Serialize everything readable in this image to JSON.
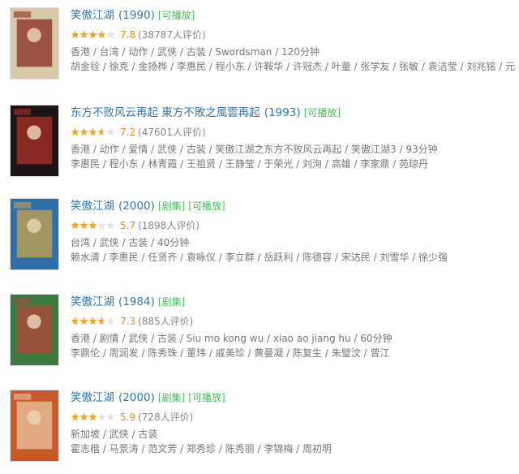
{
  "results": [
    {
      "title": "笑傲江湖",
      "year": "(1990)",
      "tags": [
        "可播放"
      ],
      "rating": 0.78,
      "score": "7.8",
      "votes": "(38787人评价)",
      "info": "香港 / 台湾 / 动作 / 武侠 / 古装 / Swordsman / 120分钟",
      "cast": "胡金铨 / 徐克 / 金扬桦 / 李惠民 / 程小东 / 许鞍华 / 许冠杰 / 叶童 / 张学友 / 张敏 / 袁洁莹 / 刘兆铭 / 元华 / 刘洵",
      "poster_colors": [
        "#d8c9a8",
        "#8a2b20"
      ]
    },
    {
      "title": "东方不败风云再起 東方不敗之風雲再起",
      "year": "(1993)",
      "tags": [
        "可播放"
      ],
      "rating": 0.72,
      "score": "7.2",
      "votes": "(47601人评价)",
      "info": "香港 / 动作 / 爱情 / 武侠 / 古装 / 笑傲江湖之东方不败风云再起 / 笑傲江湖3 / 93分钟",
      "cast": "李惠民 / 程小东 / 林青霞 / 王祖贤 / 王静莹 / 于荣光 / 刘洵 / 高雄 / 李家鼎 / 苑琼丹",
      "poster_colors": [
        "#1a1414",
        "#b0302a"
      ]
    },
    {
      "title": "笑傲江湖",
      "year": "(2000)",
      "tags": [
        "剧集",
        "可播放"
      ],
      "rating": 0.57,
      "score": "5.7",
      "votes": "(1898人评价)",
      "info": "台湾 / 武侠 / 古装 / 40分钟",
      "cast": "赖水清 / 李惠民 / 任贤齐 / 袁咏仪 / 李立群 / 岳跃利 / 陈德容 / 宋达民 / 刘雪华 / 徐少强",
      "poster_colors": [
        "#2f6fa8",
        "#c8a24a"
      ]
    },
    {
      "title": "笑傲江湖",
      "year": "(1984)",
      "tags": [
        "剧集"
      ],
      "rating": 0.73,
      "score": "7.3",
      "votes": "(885人评价)",
      "info": "香港 / 剧情 / 武侠 / 古装 / Siu mo kong wu / xiao ao jiang hu / 60分钟",
      "cast": "李鼎伦 / 周润发 / 陈秀珠 / 董玮 / 戚美珍 / 黄曼凝 / 陈复生 / 朱璧汶 / 曾江",
      "poster_colors": [
        "#3a7a3e",
        "#b5473a"
      ]
    },
    {
      "title": "笑傲江湖",
      "year": "(2000)",
      "tags": [
        "剧集",
        "可播放"
      ],
      "rating": 0.59,
      "score": "5.9",
      "votes": "(728人评价)",
      "info": "新加坡 / 武侠 / 古装",
      "cast": "霍志楷 / 马景涛 / 范文芳 / 郑秀珍 / 陈秀丽 / 李锦梅 / 周初明",
      "poster_colors": [
        "#c85a2a",
        "#e8c4a0"
      ]
    }
  ]
}
